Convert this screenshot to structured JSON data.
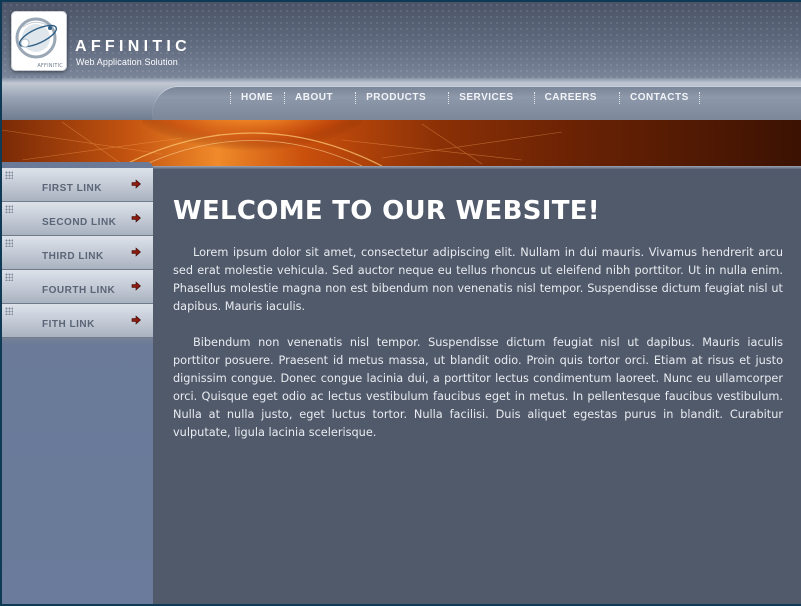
{
  "header": {
    "logo_caption": "AFFINITIC",
    "brand_name": "AFFINITIC",
    "tagline": "Web Application Solution"
  },
  "nav": {
    "items": [
      {
        "label": "HOME"
      },
      {
        "label": "ABOUT"
      },
      {
        "label": "PRODUCTS"
      },
      {
        "label": "SERVICES"
      },
      {
        "label": "CAREERS"
      },
      {
        "label": "CONTACTS"
      }
    ]
  },
  "sidebar": {
    "items": [
      {
        "label": "FIRST LINK",
        "icon": "arrow-right-icon"
      },
      {
        "label": "SECOND LINK",
        "icon": "arrow-right-icon"
      },
      {
        "label": "THIRD LINK",
        "icon": "arrow-right-icon"
      },
      {
        "label": "FOURTH LINK",
        "icon": "arrow-right-icon"
      },
      {
        "label": "FITH LINK",
        "icon": "arrow-right-icon"
      }
    ]
  },
  "main": {
    "title": "WELCOME TO OUR WEBSITE!",
    "paragraphs": [
      "Lorem ipsum dolor sit amet, consectetur adipiscing elit. Nullam in dui mauris. Vivamus hendrerit arcu sed erat molestie vehicula. Sed auctor neque eu tellus rhoncus ut eleifend nibh porttitor. Ut in nulla enim. Phasellus molestie magna non est bibendum non venenatis nisl tempor. Suspendisse dictum feugiat nisl ut dapibus. Mauris iaculis.",
      "Bibendum non venenatis nisl tempor. Suspendisse dictum feugiat nisl ut dapibus. Mauris iaculis porttitor posuere. Praesent id metus massa, ut blandit odio. Proin quis tortor orci. Etiam at risus et justo dignissim congue. Donec congue lacinia dui, a porttitor lectus condimentum laoreet. Nunc eu ullamcorper orci. Quisque eget odio ac lectus vestibulum faucibus eget in metus. In pellentesque faucibus vestibulum. Nulla at nulla justo, eget luctus tortor. Nulla facilisi. Duis aliquet egestas purus in blandit. Curabitur vulputate, ligula lacinia scelerisque."
    ]
  },
  "colors": {
    "page_bg": "#515a6b",
    "sidebar_bg": "#6b7a97",
    "banner_accent": "#f08a2a",
    "arrow": "#8b1a0f"
  }
}
